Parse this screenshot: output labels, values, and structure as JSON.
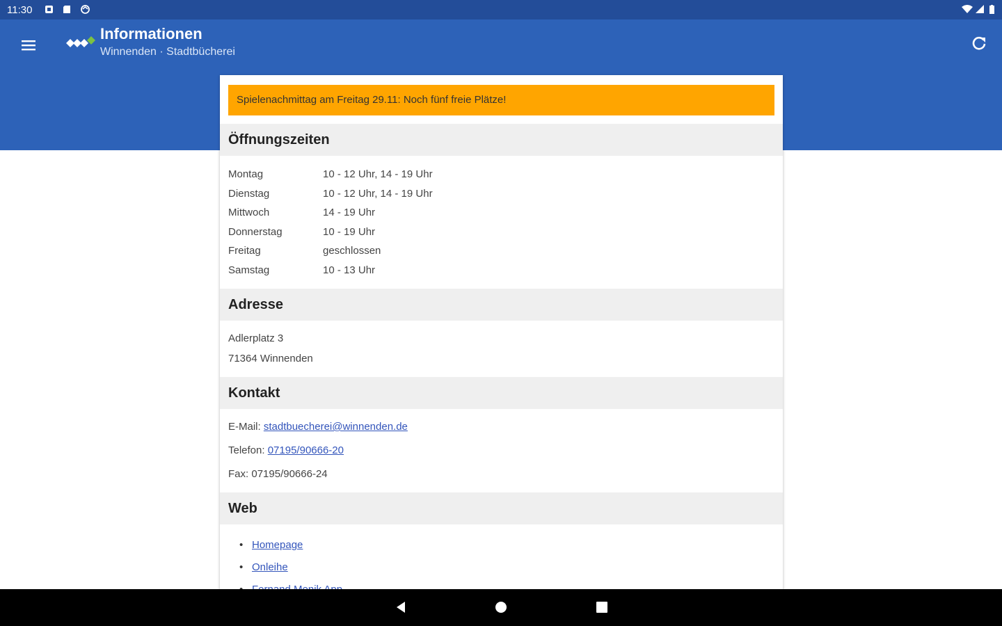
{
  "status_bar": {
    "time": "11:30",
    "left_icons": [
      "notification-icon",
      "sd-card-icon",
      "sync-icon"
    ],
    "right_icons": [
      "wifi-icon",
      "signal-icon",
      "battery-icon"
    ]
  },
  "app_bar": {
    "title": "Informationen",
    "subtitle": "Winnenden · Stadtbücherei",
    "menu_icon": "menu-icon",
    "refresh_icon": "refresh-icon",
    "color": "#2d62b8"
  },
  "banner": {
    "text": "Spielenachmittag am Freitag 29.11: Noch fünf freie Plätze!",
    "color": "#ffa500"
  },
  "opening_hours": {
    "heading": "Öffnungszeiten",
    "rows": [
      {
        "day": "Montag",
        "hours": "10 - 12 Uhr, 14 - 19 Uhr"
      },
      {
        "day": "Dienstag",
        "hours": "10 - 12 Uhr, 14 - 19 Uhr"
      },
      {
        "day": "Mittwoch",
        "hours": "14 - 19 Uhr"
      },
      {
        "day": "Donnerstag",
        "hours": "10 - 19 Uhr"
      },
      {
        "day": "Freitag",
        "hours": "geschlossen"
      },
      {
        "day": "Samstag",
        "hours": "10 - 13 Uhr"
      }
    ]
  },
  "address": {
    "heading": "Adresse",
    "lines": [
      "Adlerplatz 3",
      "71364 Winnenden"
    ]
  },
  "contact": {
    "heading": "Kontakt",
    "email_label": "E-Mail:",
    "email": "stadtbuecherei@winnenden.de",
    "phone_label": "Telefon:",
    "phone": "07195/90666-20",
    "fax_label": "Fax:",
    "fax": "07195/90666-24"
  },
  "web": {
    "heading": "Web",
    "links": [
      "Homepage",
      "Onleihe",
      "Fernand Menik App"
    ]
  },
  "nav_bar": {
    "icons": [
      "back-icon",
      "home-icon",
      "recents-icon"
    ]
  }
}
